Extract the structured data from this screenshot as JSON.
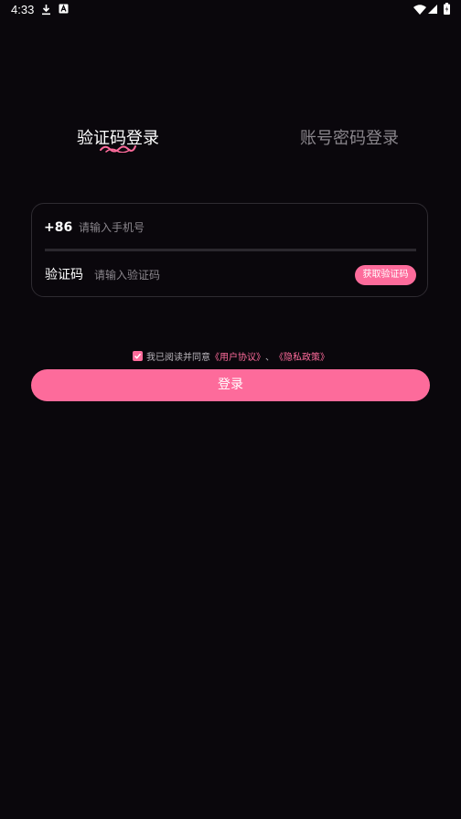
{
  "status_bar": {
    "time": "4:33",
    "left_icons": [
      "download-icon",
      "text-notification-icon"
    ],
    "right_icons": [
      "wifi-icon",
      "signal-icon",
      "battery-icon"
    ]
  },
  "tabs": [
    {
      "label": "验证码登录",
      "active": true
    },
    {
      "label": "账号密码登录",
      "active": false
    }
  ],
  "phone": {
    "country_code": "+86",
    "placeholder": "请输入手机号"
  },
  "code": {
    "label": "验证码",
    "placeholder": "请输入验证码",
    "get_code_label": "获取验证码"
  },
  "agreement": {
    "checked": true,
    "text": "我已阅读并同意",
    "user_agreement": "《用户协议》",
    "separator": "、",
    "privacy_policy": "《隐私政策》"
  },
  "login_button": "登录",
  "colors": {
    "background": "#0a070c",
    "accent": "#fd6b9b",
    "muted_text": "#8a868c"
  }
}
